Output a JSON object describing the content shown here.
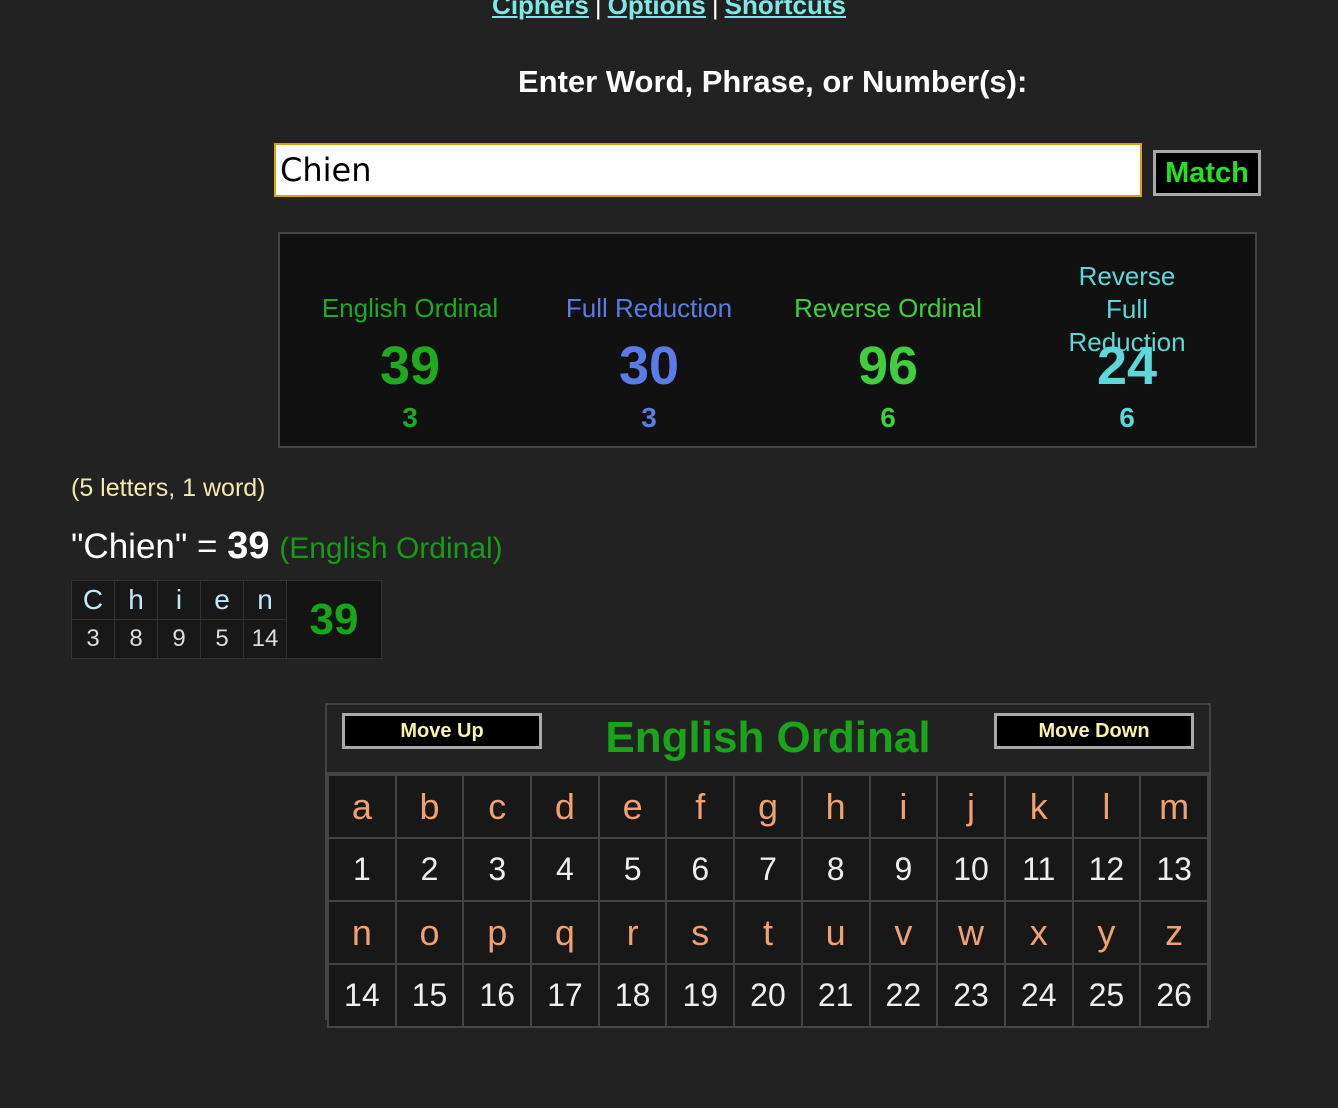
{
  "nav": {
    "items": [
      "Ciphers",
      "Options",
      "Shortcuts"
    ],
    "separator": "|"
  },
  "prompt": "Enter Word, Phrase, or Number(s):",
  "search": {
    "value": "Chien",
    "button": "Match"
  },
  "results": [
    {
      "name": "English Ordinal",
      "value": "39",
      "reduction": "3",
      "color": "#1faa1f"
    },
    {
      "name": "Full Reduction",
      "value": "30",
      "reduction": "3",
      "color": "#5b7be8"
    },
    {
      "name": "Reverse Ordinal",
      "value": "96",
      "reduction": "6",
      "color": "#3fcf3f"
    },
    {
      "name": "Reverse Full Reduction",
      "value": "24",
      "reduction": "6",
      "color": "#5dd8d8"
    }
  ],
  "info": "(5 letters, 1 word)",
  "equation": {
    "word": "\"Chien\"",
    "equals": "=",
    "value": "39",
    "cipher": "(English Ordinal)"
  },
  "breakdown": {
    "letters": [
      "C",
      "h",
      "i",
      "e",
      "n"
    ],
    "values": [
      "3",
      "8",
      "9",
      "5",
      "14"
    ],
    "total": "39"
  },
  "cipher_table": {
    "move_up": "Move Up",
    "move_down": "Move Down",
    "title": "English Ordinal",
    "row1_letters": [
      "a",
      "b",
      "c",
      "d",
      "e",
      "f",
      "g",
      "h",
      "i",
      "j",
      "k",
      "l",
      "m"
    ],
    "row1_values": [
      "1",
      "2",
      "3",
      "4",
      "5",
      "6",
      "7",
      "8",
      "9",
      "10",
      "11",
      "12",
      "13"
    ],
    "row2_letters": [
      "n",
      "o",
      "p",
      "q",
      "r",
      "s",
      "t",
      "u",
      "v",
      "w",
      "x",
      "y",
      "z"
    ],
    "row2_values": [
      "14",
      "15",
      "16",
      "17",
      "18",
      "19",
      "20",
      "21",
      "22",
      "23",
      "24",
      "25",
      "26"
    ]
  }
}
